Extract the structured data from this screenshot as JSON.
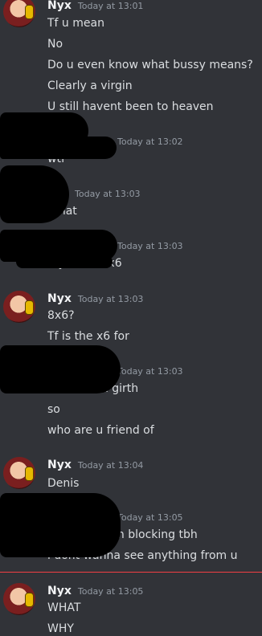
{
  "messages": [
    {
      "author": "Nyx",
      "time": "Today at 13:01",
      "lines": [
        "Tf u mean",
        "No",
        "Do u even know what bussy means?",
        "Clearly a virgin",
        "U still havent been to heaven"
      ]
    },
    {
      "author": "",
      "time": "Today at 13:02",
      "lines": [
        "wtf"
      ]
    },
    {
      "author": "",
      "time": "Today at 13:03",
      "lines": [
        "What"
      ]
    },
    {
      "author": "",
      "time": "Today at 13:03",
      "lines": [
        "my shi is 8x6"
      ]
    },
    {
      "author": "Nyx",
      "time": "Today at 13:03",
      "lines": [
        "8x6?",
        "Tf is the x6 for"
      ]
    },
    {
      "author": "",
      "time": "Today at 13:03",
      "lines": [
        "6 inches in girth",
        "so",
        "who are u friend of"
      ]
    },
    {
      "author": "Nyx",
      "time": "Today at 13:04",
      "lines": [
        "Denis"
      ]
    },
    {
      "author": "",
      "time": "Today at 13:05",
      "lines": [
        "ok enough im blocking tbh",
        "i dont wanna see anything from u"
      ]
    },
    {
      "author": "Nyx",
      "time": "Today at 13:05",
      "lines": [
        "WHAT",
        "WHY"
      ]
    }
  ]
}
